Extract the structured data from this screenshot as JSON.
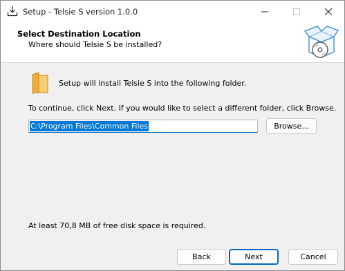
{
  "window": {
    "title": "Setup - Telsie S version 1.0.0",
    "icon": "setup-download-icon"
  },
  "caption_buttons": {
    "minimize_icon": "minimize-icon",
    "maximize_icon": "maximize-icon",
    "close_icon": "close-icon"
  },
  "header": {
    "title": "Select Destination Location",
    "subtitle": "Where should Telsie S be installed?",
    "icon": "install-box-disc-icon"
  },
  "main": {
    "intro_text": "Setup will install Telsie S into the following folder.",
    "instruction_text": "To continue, click Next. If you would like to select a different folder, click Browse.",
    "path_value": "C:\\Program Files\\Common Files",
    "browse_label": "Browse...",
    "disk_space_text": "At least 70,8 MB of free disk space is required.",
    "folder_icon": "folder-icon"
  },
  "footer": {
    "back_label": "Back",
    "next_label": "Next",
    "cancel_label": "Cancel"
  },
  "colors": {
    "accent": "#0067c0",
    "selection": "#0078d7",
    "background": "#f0f0f0"
  }
}
